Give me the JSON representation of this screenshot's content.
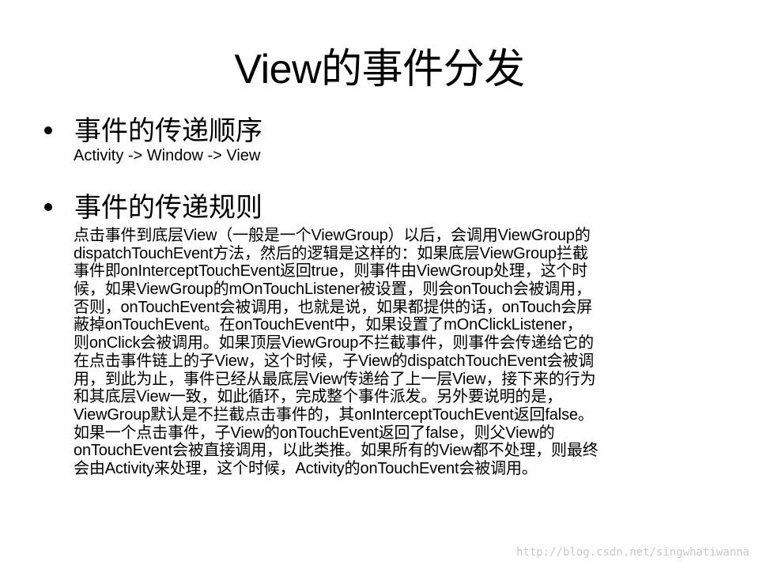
{
  "title": "View的事件分发",
  "bullets": [
    {
      "heading": "事件的传递顺序",
      "sub": "Activity -> Window -> View"
    },
    {
      "heading": "事件的传递规则",
      "lines": [
        "点击事件到底层View（一般是一个ViewGroup）以后，会调用ViewGroup的",
        "dispatchTouchEvent方法，然后的逻辑是这样的：如果底层ViewGroup拦截",
        "事件即onInterceptTouchEvent返回true，则事件由ViewGroup处理，这个时",
        "候，如果ViewGroup的mOnTouchListener被设置，则会onTouch会被调用，",
        "否则，onTouchEvent会被调用，也就是说，如果都提供的话，onTouch会屏",
        "蔽掉onTouchEvent。在onTouchEvent中，如果设置了mOnClickListener，",
        "则onClick会被调用。如果顶层ViewGroup不拦截事件，则事件会传递给它的",
        "在点击事件链上的子View，这个时候，子View的dispatchTouchEvent会被调",
        "用，到此为止，事件已经从最底层View传递给了上一层View，接下来的行为",
        "和其底层View一致，如此循环，完成整个事件派发。另外要说明的是，",
        "ViewGroup默认是不拦截点击事件的，其onInterceptTouchEvent返回false。",
        "如果一个点击事件，子View的onTouchEvent返回了false，则父View的",
        "onTouchEvent会被直接调用，以此类推。如果所有的View都不处理，则最终",
        "会由Activity来处理，这个时候，Activity的onTouchEvent会被调用。"
      ]
    }
  ],
  "watermark": "http://blog.csdn.net/singwhatiwanna",
  "colors": {
    "background": "#ffffff",
    "text": "#000000",
    "watermark": "#c8c8c8"
  }
}
